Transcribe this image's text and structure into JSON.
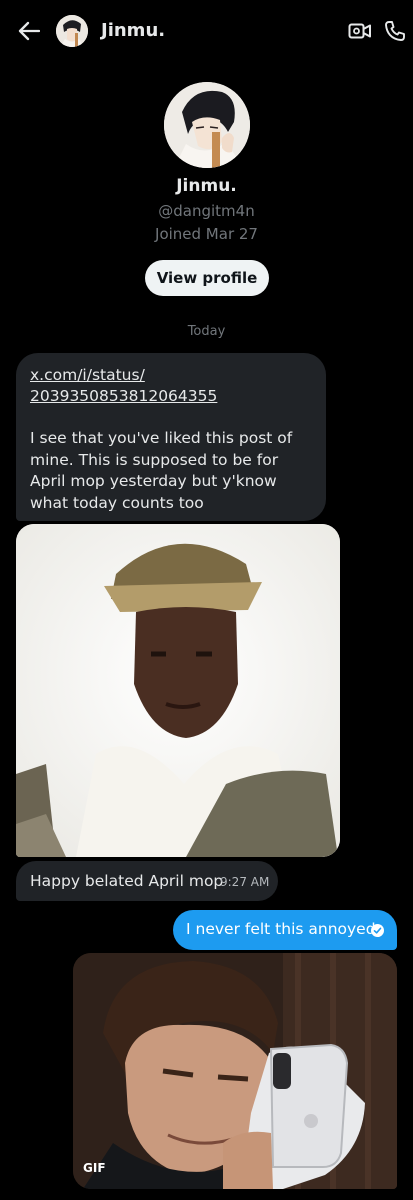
{
  "header": {
    "title": "Jinmu.",
    "back_icon": "arrow-left-icon",
    "video_icon": "video-call-icon",
    "call_icon": "phone-icon"
  },
  "profile": {
    "name": "Jinmu.",
    "handle": "@dangitm4n",
    "joined": "Joined Mar 27",
    "view_profile_label": "View profile"
  },
  "conversation": {
    "date_label": "Today",
    "messages": [
      {
        "direction": "incoming",
        "link_line1": "x.com/i/status/",
        "link_line2": "2039350853812064355",
        "text": "I see that you've liked this post of mine. This is supposed to be for April mop yesterday but y'know what today counts too"
      },
      {
        "direction": "incoming",
        "type": "image"
      },
      {
        "direction": "incoming",
        "text": "Happy belated April mop",
        "time": "9:27 AM"
      },
      {
        "direction": "outgoing",
        "text": "I never felt this annoyed",
        "status_icon": "read-check-icon"
      },
      {
        "direction": "outgoing",
        "type": "gif",
        "badge": "GIF"
      }
    ]
  },
  "colors": {
    "background": "#000000",
    "incoming_bubble": "#202327",
    "outgoing_bubble": "#1d9bf0",
    "secondary_text": "#71767b",
    "primary_text": "#e7e9ea"
  }
}
